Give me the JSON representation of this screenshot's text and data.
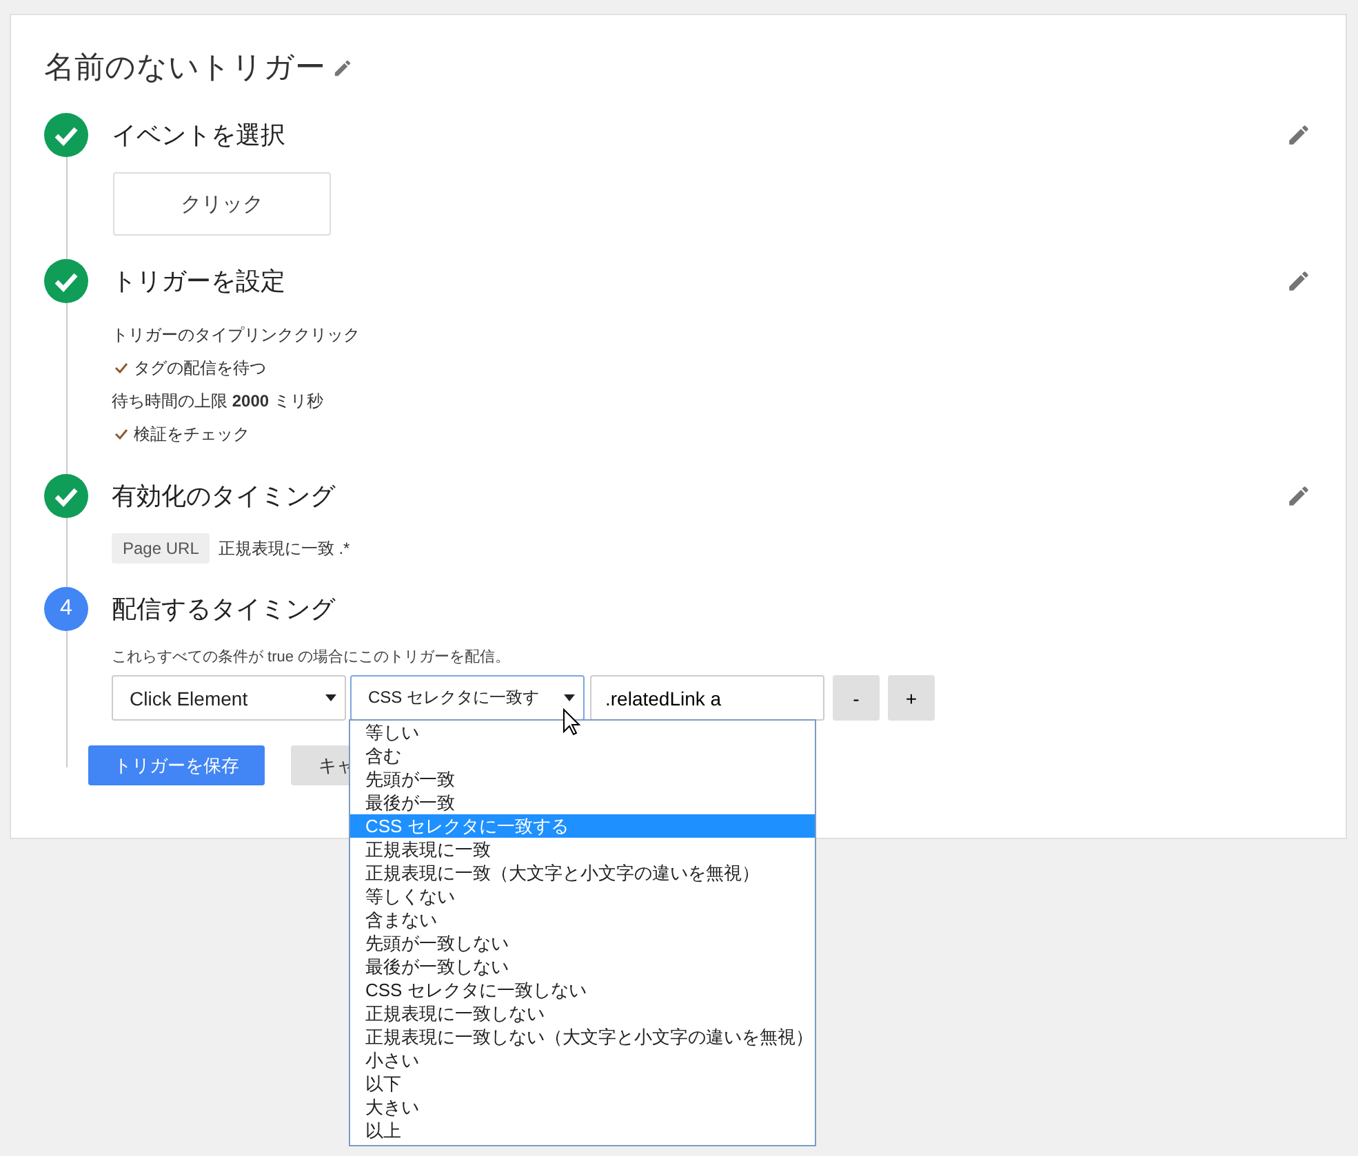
{
  "title": "名前のないトリガー",
  "steps": [
    {
      "kind": "done",
      "title": "イベントを選択",
      "editable": true,
      "event": "クリック"
    },
    {
      "kind": "done",
      "title": "トリガーを設定",
      "editable": true,
      "lines": [
        {
          "kind": "plain",
          "text": "トリガーのタイプリンククリック"
        },
        {
          "kind": "check",
          "text": "タグの配信を待つ"
        },
        {
          "kind": "plain",
          "text": "待ち時間の上限 **2000** ミリ秒"
        },
        {
          "kind": "check",
          "text": "検証をチェック"
        }
      ]
    },
    {
      "kind": "done",
      "title": "有効化のタイミング",
      "editable": true,
      "chip": "Page URL",
      "condition": "正規表現に一致 .*"
    },
    {
      "kind": "current",
      "number": "4",
      "title": "配信するタイミング",
      "editable": false,
      "note": "これらすべての条件が true の場合にこのトリガーを配信。",
      "row": {
        "variable": "Click Element",
        "operator": "CSS セレクタに一致す",
        "value": ".relatedLink a",
        "remove": "-",
        "add": "+",
        "options": [
          {
            "label": "等しい",
            "selected": false
          },
          {
            "label": "含む",
            "selected": false
          },
          {
            "label": "先頭が一致",
            "selected": false
          },
          {
            "label": "最後が一致",
            "selected": false
          },
          {
            "label": "CSS セレクタに一致する",
            "selected": true
          },
          {
            "label": "正規表現に一致",
            "selected": false
          },
          {
            "label": "正規表現に一致（大文字と小文字の違いを無視）",
            "selected": false
          },
          {
            "label": "等しくない",
            "selected": false
          },
          {
            "label": "含まない",
            "selected": false
          },
          {
            "label": "先頭が一致しない",
            "selected": false
          },
          {
            "label": "最後が一致しない",
            "selected": false
          },
          {
            "label": "CSS セレクタに一致しない",
            "selected": false
          },
          {
            "label": "正規表現に一致しない",
            "selected": false
          },
          {
            "label": "正規表現に一致しない（大文字と小文字の違いを無視）",
            "selected": false
          },
          {
            "label": "小さい",
            "selected": false
          },
          {
            "label": "以下",
            "selected": false
          },
          {
            "label": "大きい",
            "selected": false
          },
          {
            "label": "以上",
            "selected": false
          }
        ]
      }
    }
  ],
  "buttons": [
    {
      "kind": "primary",
      "label": "トリガーを保存"
    },
    {
      "kind": "secondary",
      "label": "キャ"
    }
  ]
}
